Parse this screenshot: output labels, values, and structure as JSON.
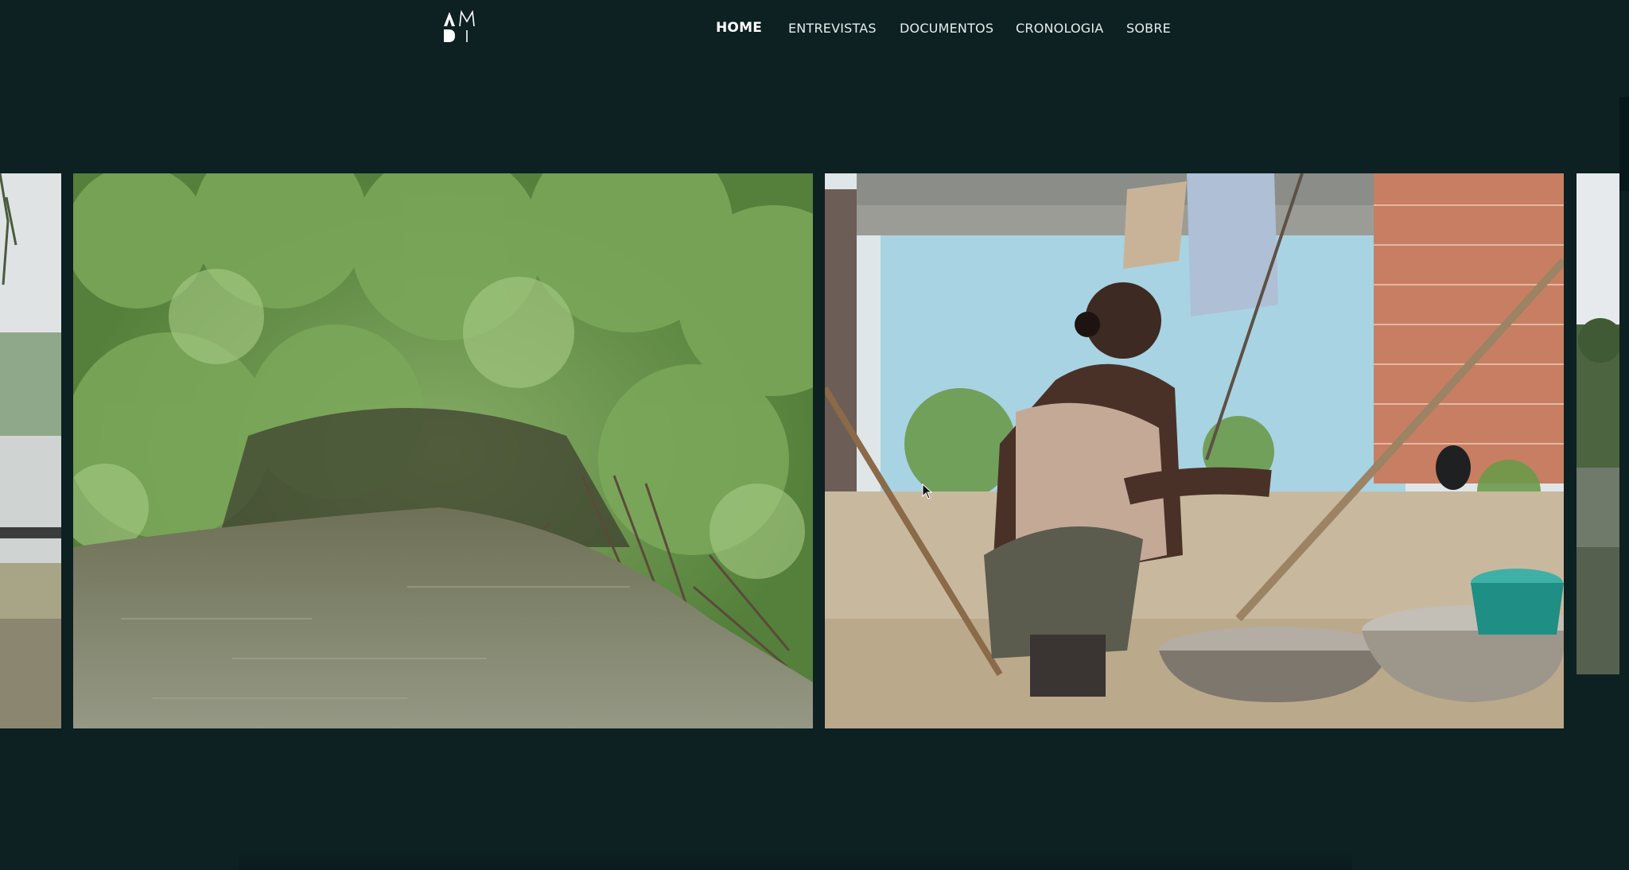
{
  "header": {
    "logo_icon": "amdi-logo-icon",
    "nav": [
      {
        "label": "HOME",
        "active": true
      },
      {
        "label": "ENTREVISTAS",
        "active": false
      },
      {
        "label": "DOCUMENTOS",
        "active": false
      },
      {
        "label": "CRONOLOGIA",
        "active": false
      },
      {
        "label": "SOBRE",
        "active": false
      }
    ]
  },
  "carousel": {
    "slides": [
      {
        "content": "mangrove-shore-photo"
      },
      {
        "content": "mangrove-water-photo"
      },
      {
        "content": "woman-squatting-basins-photo"
      },
      {
        "content": "river-trees-photo"
      }
    ]
  },
  "colors": {
    "background": "#0d2022",
    "nav_text": "#e8eeee"
  }
}
